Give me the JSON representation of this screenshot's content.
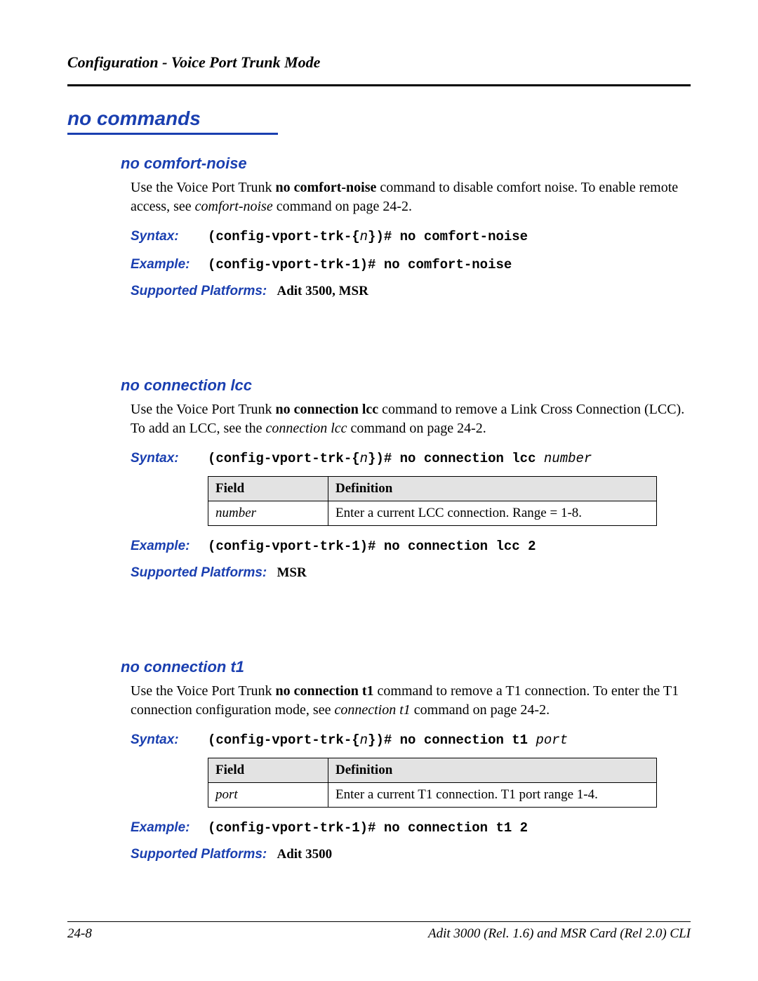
{
  "running_head": "Configuration - Voice Port Trunk Mode",
  "h1": "no commands",
  "labels": {
    "syntax": "Syntax:",
    "example": "Example:",
    "platforms": "Supported Platforms:",
    "field_col": "Field",
    "def_col": "Definition"
  },
  "syntax_prefix": "(config-vport-trk-{",
  "syntax_n": "n",
  "syntax_suffix": "})# ",
  "sections": [
    {
      "title": "no comfort-noise",
      "para_pre": "Use the Voice Port Trunk ",
      "para_bold": "no comfort-noise",
      "para_post1": " command to disable comfort noise. To enable remote access, see ",
      "para_ital": "comfort-noise",
      "para_post2": " command on page 24-2.",
      "syntax_cmd": "no comfort-noise",
      "syntax_param": "",
      "example": "(config-vport-trk-1)# no comfort-noise",
      "platforms": "Adit 3500, MSR",
      "has_table": false
    },
    {
      "title": "no connection lcc",
      "para_pre": "Use the Voice Port Trunk ",
      "para_bold": "no connection lcc",
      "para_post1": " command to remove a Link Cross Connection (LCC). To add an LCC, see the ",
      "para_ital": "connection lcc",
      "para_post2": " command on page 24-2.",
      "syntax_cmd": "no connection lcc ",
      "syntax_param": "number",
      "example": "(config-vport-trk-1)# no connection lcc 2",
      "platforms": "MSR",
      "has_table": true,
      "table_field": "number",
      "table_def": "Enter a current LCC connection.  Range = 1-8."
    },
    {
      "title": "no connection t1",
      "para_pre": "Use the Voice Port Trunk ",
      "para_bold": "no connection t1",
      "para_post1": " command to remove a T1 connection. To enter the T1 connection configuration mode, see ",
      "para_ital": "connection t1",
      "para_post2": " command on page 24-2.",
      "syntax_cmd": "no connection t1 ",
      "syntax_param": "port",
      "example": "(config-vport-trk-1)# no connection t1 2",
      "platforms": "Adit 3500",
      "has_table": true,
      "table_field": "port",
      "table_def": "Enter a current T1 connection. T1 port range 1-4."
    }
  ],
  "footer": {
    "page_num": "24-8",
    "doc_title": "Adit 3000 (Rel. 1.6) and MSR Card (Rel 2.0) CLI"
  }
}
